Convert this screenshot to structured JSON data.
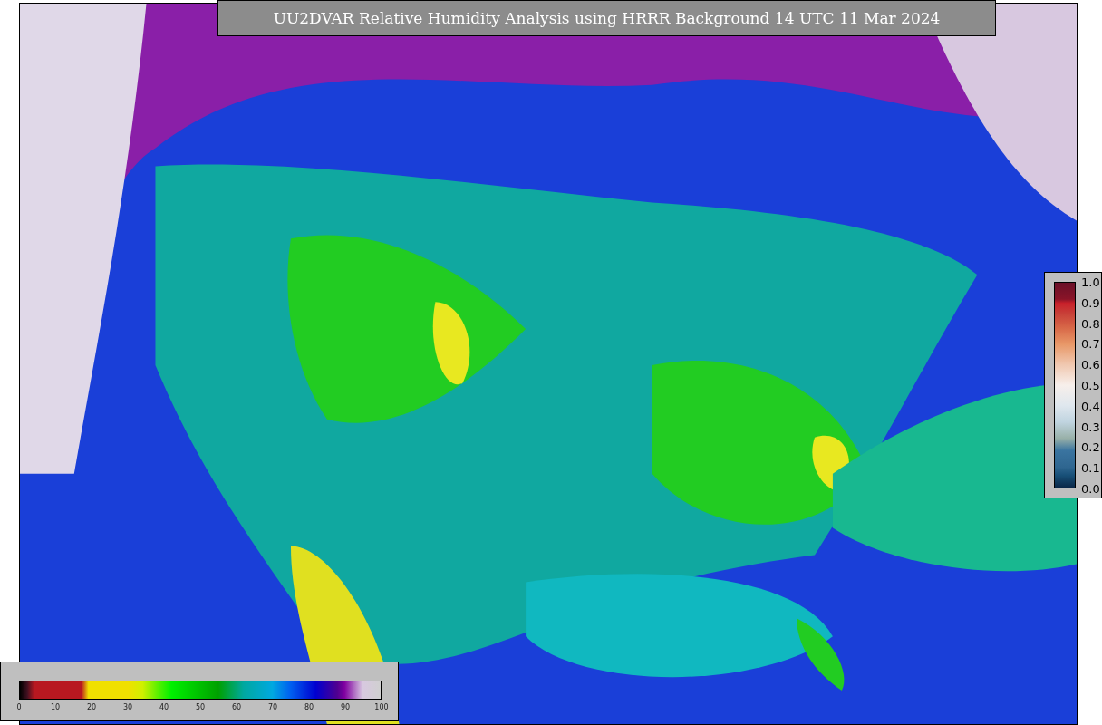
{
  "title": "UU2DVAR Relative Humidity Analysis using HRRR Background 14 UTC 11 Mar 2024",
  "vertical_colorbar": {
    "ticks": [
      "1.0",
      "0.9",
      "0.8",
      "0.7",
      "0.6",
      "0.5",
      "0.4",
      "0.3",
      "0.2",
      "0.1",
      "0.0"
    ]
  },
  "horizontal_colorbar": {
    "ticks": [
      "0",
      "10",
      "20",
      "30",
      "40",
      "50",
      "60",
      "70",
      "80",
      "90",
      "100"
    ]
  }
}
